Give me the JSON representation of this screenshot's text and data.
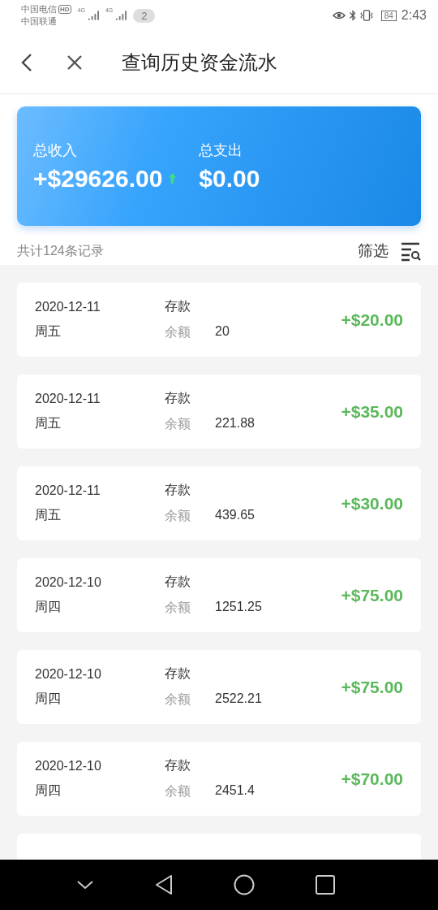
{
  "status_bar": {
    "carrier_1": "中国电信",
    "hd_badge": "HD",
    "network_1": "4G",
    "carrier_2": "中国联通",
    "network_2": "4G",
    "notification_count": "2",
    "battery": "84",
    "time": "2:43"
  },
  "header": {
    "title": "查询历史资金流水"
  },
  "summary": {
    "income_label": "总收入",
    "income_value": "+$29626.00",
    "expense_label": "总支出",
    "expense_value": "$0.00"
  },
  "record_count": "共计124条记录",
  "filter_label": "筛选",
  "records": [
    {
      "date": "2020-12-11",
      "weekday": "周五",
      "type": "存款",
      "balance_label": "余额",
      "balance": "20",
      "amount": "+$20.00"
    },
    {
      "date": "2020-12-11",
      "weekday": "周五",
      "type": "存款",
      "balance_label": "余额",
      "balance": "221.88",
      "amount": "+$35.00"
    },
    {
      "date": "2020-12-11",
      "weekday": "周五",
      "type": "存款",
      "balance_label": "余额",
      "balance": "439.65",
      "amount": "+$30.00"
    },
    {
      "date": "2020-12-10",
      "weekday": "周四",
      "type": "存款",
      "balance_label": "余额",
      "balance": "1251.25",
      "amount": "+$75.00"
    },
    {
      "date": "2020-12-10",
      "weekday": "周四",
      "type": "存款",
      "balance_label": "余额",
      "balance": "2522.21",
      "amount": "+$75.00"
    },
    {
      "date": "2020-12-10",
      "weekday": "周四",
      "type": "存款",
      "balance_label": "余额",
      "balance": "2451.4",
      "amount": "+$70.00"
    }
  ]
}
